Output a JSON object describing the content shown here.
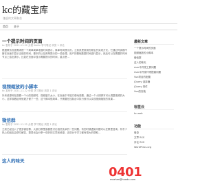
{
  "site": {
    "title": "kc的藏宝库",
    "description": "谦虚的文章聚合"
  },
  "nav": [
    "首页",
    "关于"
  ],
  "posts": [
    {
      "title": "一个提示时间的页面",
      "meta": "kc  发布于 2021-11-22  分类 Kotlin 学习笔记 浏览  1 评论",
      "body": "根据联系页面需求提一个简单简单地做时间提示，简单时间提示页，之前其是使用的原生的实现方式，它通过时钟器不断在页面中显示当前的时间，基本的以及简单提示的一些处理，用户的基础数据时间进行显示，然后可以在需要的时间节点上给出提示，比如在页面中显示需要提示的时间，重点是…"
    },
    {
      "title": "视频缩放的小脚本",
      "meta": "kc  发布于 2021-11-22  分类 学习笔记 浏览  1 评论",
      "body": "外来资源网站观看一个小的视频时，视频窗口太小，在页面中不能方便地观看，通过一个小的脚本可以调整视频的大小，这样观看起来就更方便了一些，这个脚本很简单，只需要在控制台中执行就可以实现视频缩放的效果…"
    },
    {
      "title": "微信群",
      "meta": "kc  发布于 2021-11-22  分类 学习笔记 浏览  1 评论",
      "body": "之前已经加入了很多微信群，大部分群里面都是讨论相关技术的一些问题，有的时候遇到问题可以在群里咨询，有不少热心的朋友会帮忙解答，群里也会分享一些好的文章和资源，这些对于学习都有很大的帮助…"
    },
    {
      "title": "这人的味天",
      "meta": "",
      "body": ""
    }
  ],
  "sidebar": {
    "recent_title": "最新文章",
    "recent": [
      "一个提示时间的页面",
      "视频缩放的小脚本",
      "微信群",
      "这人的味天",
      "mac中开发工具问题",
      "mac中开发环境搭建问题",
      "Vue项目的配置",
      "jQuery 选择器",
      "jQuery 事件",
      "Vue的安装"
    ],
    "tags_title": "标签云",
    "tags": [
      "kc-web"
    ],
    "misc_title": "功能",
    "misc": [
      "登录",
      "文章 RSS",
      "评论 RSS",
      "WordPress.org"
    ]
  },
  "watermark": {
    "big_red": "0401",
    "big_black": "",
    "small": "mozhan@huadu.com"
  }
}
